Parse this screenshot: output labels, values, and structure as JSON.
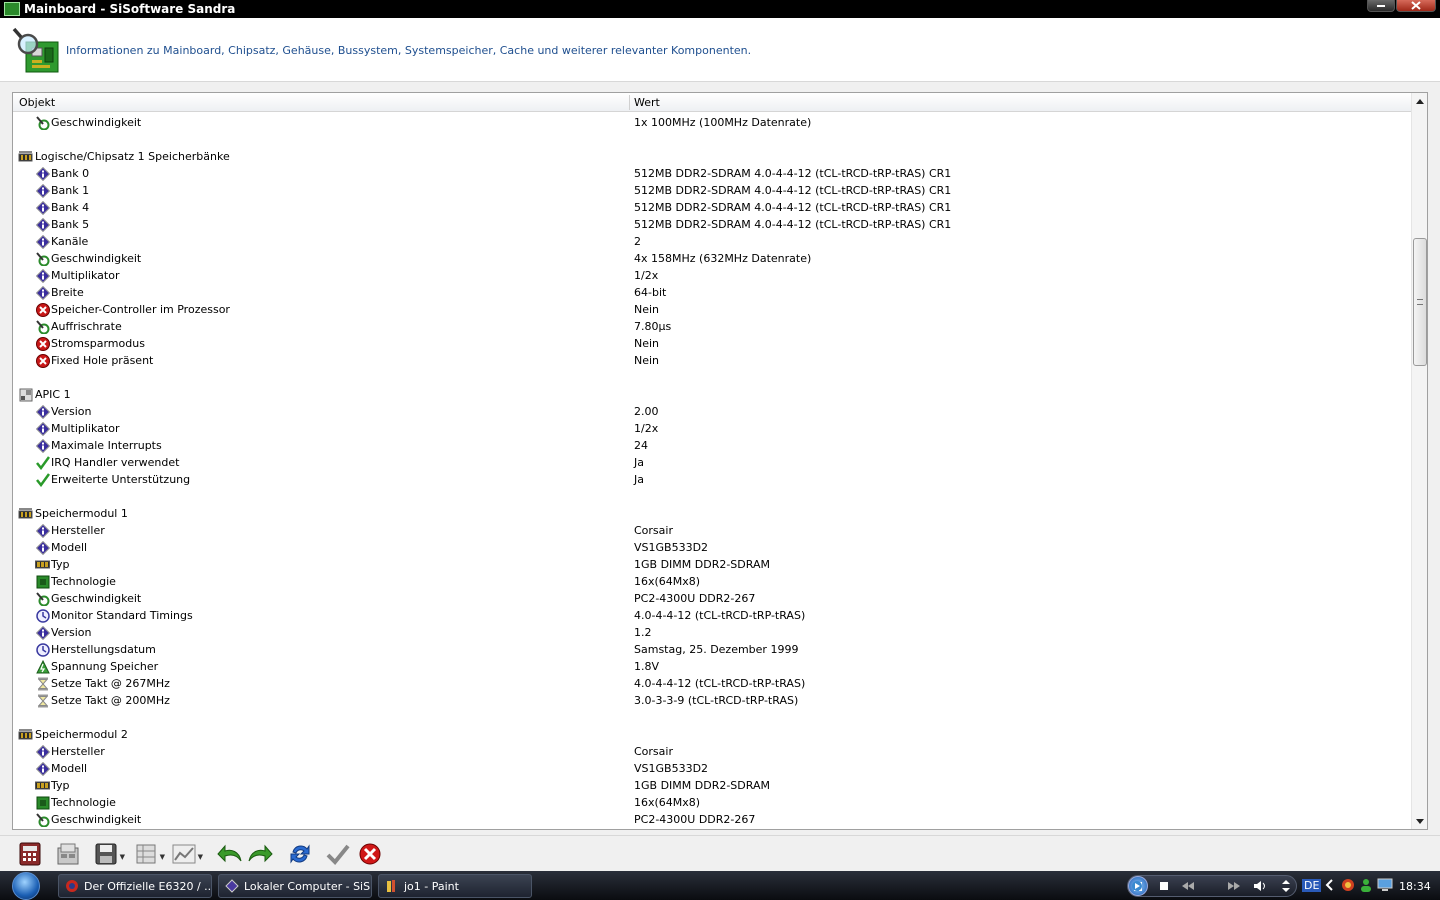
{
  "window": {
    "title": "Mainboard - SiSoftware Sandra"
  },
  "header": {
    "description": "Informationen zu Mainboard, Chipsatz, Gehäuse, Bussystem, Systemspeicher, Cache und weiterer relevanter Komponenten."
  },
  "columns": {
    "object": "Objekt",
    "value": "Wert"
  },
  "rows": [
    {
      "type": "child",
      "icon": "speed",
      "label": "Geschwindigkeit",
      "value": "1x 100MHz (100MHz Datenrate)"
    },
    {
      "type": "blank"
    },
    {
      "type": "group",
      "icon": "memory",
      "label": "Logische/Chipsatz 1 Speicherbänke"
    },
    {
      "type": "child",
      "icon": "info",
      "label": "Bank 0",
      "value": "512MB DDR2-SDRAM 4.0-4-4-12 (tCL-tRCD-tRP-tRAS) CR1"
    },
    {
      "type": "child",
      "icon": "info",
      "label": "Bank 1",
      "value": "512MB DDR2-SDRAM 4.0-4-4-12 (tCL-tRCD-tRP-tRAS) CR1"
    },
    {
      "type": "child",
      "icon": "info",
      "label": "Bank 4",
      "value": "512MB DDR2-SDRAM 4.0-4-4-12 (tCL-tRCD-tRP-tRAS) CR1"
    },
    {
      "type": "child",
      "icon": "info",
      "label": "Bank 5",
      "value": "512MB DDR2-SDRAM 4.0-4-4-12 (tCL-tRCD-tRP-tRAS) CR1"
    },
    {
      "type": "child",
      "icon": "info",
      "label": "Kanäle",
      "value": "2"
    },
    {
      "type": "child",
      "icon": "speed",
      "label": "Geschwindigkeit",
      "value": "4x 158MHz (632MHz Datenrate)"
    },
    {
      "type": "child",
      "icon": "info",
      "label": "Multiplikator",
      "value": "1/2x"
    },
    {
      "type": "child",
      "icon": "info",
      "label": "Breite",
      "value": "64-bit"
    },
    {
      "type": "child",
      "icon": "no",
      "label": "Speicher-Controller im Prozessor",
      "value": "Nein"
    },
    {
      "type": "child",
      "icon": "speed",
      "label": "Auffrischrate",
      "value": "7.80µs"
    },
    {
      "type": "child",
      "icon": "no",
      "label": "Stromsparmodus",
      "value": "Nein"
    },
    {
      "type": "child",
      "icon": "no",
      "label": "Fixed Hole präsent",
      "value": "Nein"
    },
    {
      "type": "blank"
    },
    {
      "type": "group",
      "icon": "apic",
      "label": "APIC 1"
    },
    {
      "type": "child",
      "icon": "info",
      "label": "Version",
      "value": "2.00"
    },
    {
      "type": "child",
      "icon": "info",
      "label": "Multiplikator",
      "value": "1/2x"
    },
    {
      "type": "child",
      "icon": "info",
      "label": "Maximale Interrupts",
      "value": "24"
    },
    {
      "type": "child",
      "icon": "yes",
      "label": "IRQ Handler verwendet",
      "value": "Ja"
    },
    {
      "type": "child",
      "icon": "yes",
      "label": "Erweiterte Unterstützung",
      "value": "Ja"
    },
    {
      "type": "blank"
    },
    {
      "type": "group",
      "icon": "memory",
      "label": "Speichermodul 1"
    },
    {
      "type": "child",
      "icon": "info",
      "label": "Hersteller",
      "value": "Corsair"
    },
    {
      "type": "child",
      "icon": "info",
      "label": "Modell",
      "value": "VS1GB533D2"
    },
    {
      "type": "child",
      "icon": "ram",
      "label": "Typ",
      "value": "1GB DIMM DDR2-SDRAM"
    },
    {
      "type": "child",
      "icon": "chip",
      "label": "Technologie",
      "value": "16x(64Mx8)"
    },
    {
      "type": "child",
      "icon": "speed",
      "label": "Geschwindigkeit",
      "value": "PC2-4300U DDR2-267"
    },
    {
      "type": "child",
      "icon": "clock",
      "label": "Monitor Standard Timings",
      "value": "4.0-4-4-12 (tCL-tRCD-tRP-tRAS)"
    },
    {
      "type": "child",
      "icon": "info",
      "label": "Version",
      "value": "1.2"
    },
    {
      "type": "child",
      "icon": "clock",
      "label": "Herstellungsdatum",
      "value": "Samstag, 25. Dezember 1999"
    },
    {
      "type": "child",
      "icon": "voltage",
      "label": "Spannung Speicher",
      "value": "1.8V"
    },
    {
      "type": "child",
      "icon": "hourglass",
      "label": "Setze Takt @ 267MHz",
      "value": "4.0-4-4-12 (tCL-tRCD-tRP-tRAS)"
    },
    {
      "type": "child",
      "icon": "hourglass",
      "label": "Setze Takt @ 200MHz",
      "value": "3.0-3-3-9 (tCL-tRCD-tRP-tRAS)"
    },
    {
      "type": "blank"
    },
    {
      "type": "group",
      "icon": "memory",
      "label": "Speichermodul 2"
    },
    {
      "type": "child",
      "icon": "info",
      "label": "Hersteller",
      "value": "Corsair"
    },
    {
      "type": "child",
      "icon": "info",
      "label": "Modell",
      "value": "VS1GB533D2"
    },
    {
      "type": "child",
      "icon": "ram",
      "label": "Typ",
      "value": "1GB DIMM DDR2-SDRAM"
    },
    {
      "type": "child",
      "icon": "chip",
      "label": "Technologie",
      "value": "16x(64Mx8)"
    },
    {
      "type": "child",
      "icon": "speed",
      "label": "Geschwindigkeit",
      "value": "PC2-4300U DDR2-267"
    }
  ],
  "toolbar": {
    "buttons": [
      {
        "name": "report-wizard-button",
        "icon": "calculator-icon"
      },
      {
        "name": "options-button",
        "icon": "options-icon"
      },
      {
        "name": "save-button",
        "icon": "floppy-icon"
      },
      {
        "name": "compare-button",
        "icon": "compare-icon"
      },
      {
        "name": "chart-button",
        "icon": "chart-icon"
      },
      {
        "name": "back-button",
        "icon": "undo-arrow-icon"
      },
      {
        "name": "forward-button",
        "icon": "redo-arrow-icon"
      },
      {
        "name": "refresh-button",
        "icon": "refresh-icon"
      },
      {
        "name": "ok-button",
        "icon": "checkmark-icon"
      },
      {
        "name": "cancel-button",
        "icon": "cancel-x-icon"
      }
    ]
  },
  "taskbar": {
    "items": [
      {
        "label": "Der Offizielle E6320 / ...",
        "active": false
      },
      {
        "label": "Lokaler Computer - SiS...",
        "active": false
      },
      {
        "label": "jo1 - Paint",
        "active": false
      }
    ],
    "language": "DE",
    "time": "18:34"
  }
}
